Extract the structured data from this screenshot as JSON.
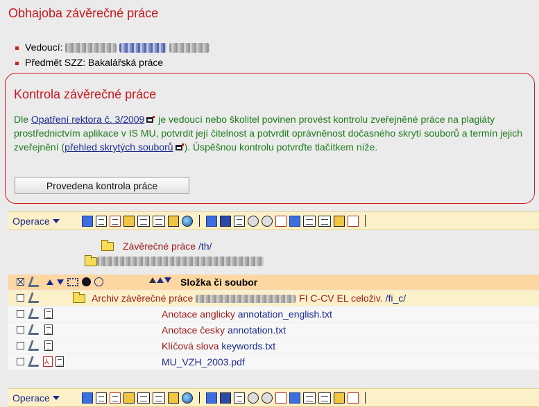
{
  "defense": {
    "title": "Obhajoba závěrečné práce",
    "supervisor_label": "Vedoucí:",
    "subject_label": "Předmět SZZ: Bakalářská práce"
  },
  "check": {
    "title": "Kontrola závěrečné práce",
    "text_1": "Dle ",
    "link_regulation": "Opatření rektora č. 3/2009",
    "text_2": " je vedoucí nebo školitel povinen provést kontrolu zveřejněné práce na plagiáty prostřednictvím aplikace v IS MU, potvrdit její čitelnost a potvrdit oprávněnost dočasného skrytí souborů a termín jejich zveřejnění (",
    "link_hidden": "přehled skrytých souborů",
    "text_3": "). Úspěšnou kontrolu potvrďte tlačítkem níže.",
    "button_label": "Provedena kontrola práce"
  },
  "toolbar": {
    "operations_label": "Operace",
    "icons_group_1": [
      "collapse-icon",
      "new-file-icon",
      "new-file-star-icon",
      "new-folder-icon",
      "copy-icon",
      "copy-icon",
      "move-icon",
      "globe-icon"
    ],
    "icons_group_2": [
      "copy-selected-icon",
      "trash-icon",
      "edit-icon",
      "settings-icon",
      "gears-icon",
      "mask-icon",
      "sort-numeric-icon",
      "copy-icon",
      "copy-icon",
      "upload-icon",
      "help-icon"
    ]
  },
  "tree": {
    "folder_theses": "Závěrečné práce",
    "folder_theses_path": "/th/"
  },
  "table": {
    "header_label": "Složka či soubor",
    "archive_label": "Archiv závěrečné práce",
    "archive_suffix": "FI C-CV EL celoživ.",
    "archive_path": "/fi_c/",
    "rows": [
      {
        "label": "Anotace anglicky",
        "file": "annotation_english.txt"
      },
      {
        "label": "Anotace česky",
        "file": "annotation.txt"
      },
      {
        "label": "Klíčová slova",
        "file": "keywords.txt"
      },
      {
        "label": "",
        "file": "MU_VZH_2003.pdf"
      }
    ]
  },
  "colors": {
    "title_red": "#c8181e",
    "text_green": "#1d7a1d",
    "link_blue": "#1a2a8c",
    "toolbar_bg": "#fbf0c8",
    "header_bg": "#fcd7a2"
  }
}
